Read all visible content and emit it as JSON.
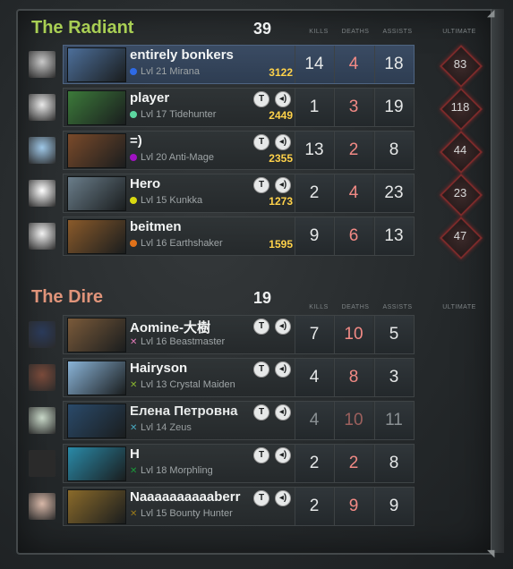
{
  "columns": {
    "kills": "KILLS",
    "deaths": "DEATHS",
    "assists": "ASSISTS",
    "ultimate": "ULTIMATE"
  },
  "radiant": {
    "title": "The Radiant",
    "score": "39",
    "players": [
      {
        "name": "entirely bonkers",
        "level": "Lvl 21 Mirana",
        "gold": "3122",
        "kills": "14",
        "deaths": "4",
        "assists": "18",
        "ultimate": "83",
        "dot_color": "#2e6ae6",
        "highlight": true,
        "buttons": false,
        "avatar_color": "#c9c9c9",
        "portrait_color": "#4d6f9a"
      },
      {
        "name": "player",
        "level": "Lvl 17 Tidehunter",
        "gold": "2449",
        "kills": "1",
        "deaths": "3",
        "assists": "19",
        "ultimate": "118",
        "dot_color": "#5cd6a0",
        "highlight": false,
        "buttons": true,
        "avatar_color": "#e9e9e9",
        "portrait_color": "#3c7a3a"
      },
      {
        "name": "=)",
        "level": "Lvl 20 Anti-Mage",
        "gold": "2355",
        "kills": "13",
        "deaths": "2",
        "assists": "8",
        "ultimate": "44",
        "dot_color": "#a012c2",
        "highlight": false,
        "buttons": true,
        "avatar_color": "#9fc8e8",
        "portrait_color": "#7a4a2a"
      },
      {
        "name": "Hero",
        "level": "Lvl 15 Kunkka",
        "gold": "1273",
        "kills": "2",
        "deaths": "4",
        "assists": "23",
        "ultimate": "23",
        "dot_color": "#d8d810",
        "highlight": false,
        "buttons": true,
        "avatar_color": "#ffffff",
        "portrait_color": "#6a7d8a"
      },
      {
        "name": "beitmen",
        "level": "Lvl 16 Earthshaker",
        "gold": "1595",
        "kills": "9",
        "deaths": "6",
        "assists": "13",
        "ultimate": "47",
        "dot_color": "#e0721a",
        "highlight": false,
        "buttons": false,
        "avatar_color": "#f2f2f2",
        "portrait_color": "#8a5a2a"
      }
    ]
  },
  "dire": {
    "title": "The Dire",
    "score": "19",
    "players": [
      {
        "name": "Aomine-大樹",
        "level": "Lvl 16 Beastmaster",
        "gold": "",
        "kills": "7",
        "deaths": "10",
        "assists": "5",
        "dot_color": "#e07ab8",
        "highlight": false,
        "dim": false,
        "buttons": true,
        "avatar_color": "#2a3a5a",
        "portrait_color": "#7a5a3a"
      },
      {
        "name": "Hairyson",
        "level": "Lvl 13 Crystal Maiden",
        "gold": "",
        "kills": "4",
        "deaths": "8",
        "assists": "3",
        "dot_color": "#8ab630",
        "highlight": false,
        "dim": false,
        "buttons": true,
        "avatar_color": "#7a4a3a",
        "portrait_color": "#8ab4d8"
      },
      {
        "name": "Елена Петровна",
        "level": "Lvl 14 Zeus",
        "gold": "",
        "kills": "4",
        "deaths": "10",
        "assists": "11",
        "dot_color": "#4ab0c8",
        "highlight": false,
        "dim": true,
        "buttons": true,
        "avatar_color": "#c8d8c8",
        "portrait_color": "#2a4a6a"
      },
      {
        "name": "H",
        "level": "Lvl 18 Morphling",
        "gold": "",
        "kills": "2",
        "deaths": "2",
        "assists": "8",
        "dot_color": "#1a9a3a",
        "highlight": false,
        "dim": false,
        "buttons": true,
        "avatar_color": "#2a2a2a",
        "portrait_color": "#2a8aa8"
      },
      {
        "name": "Naaaaaaaaaaberr",
        "level": "Lvl 15 Bounty Hunter",
        "gold": "",
        "kills": "2",
        "deaths": "9",
        "assists": "9",
        "dot_color": "#9a7a1a",
        "highlight": false,
        "dim": false,
        "buttons": true,
        "avatar_color": "#d8b8a8",
        "portrait_color": "#8a6a2a"
      }
    ]
  }
}
